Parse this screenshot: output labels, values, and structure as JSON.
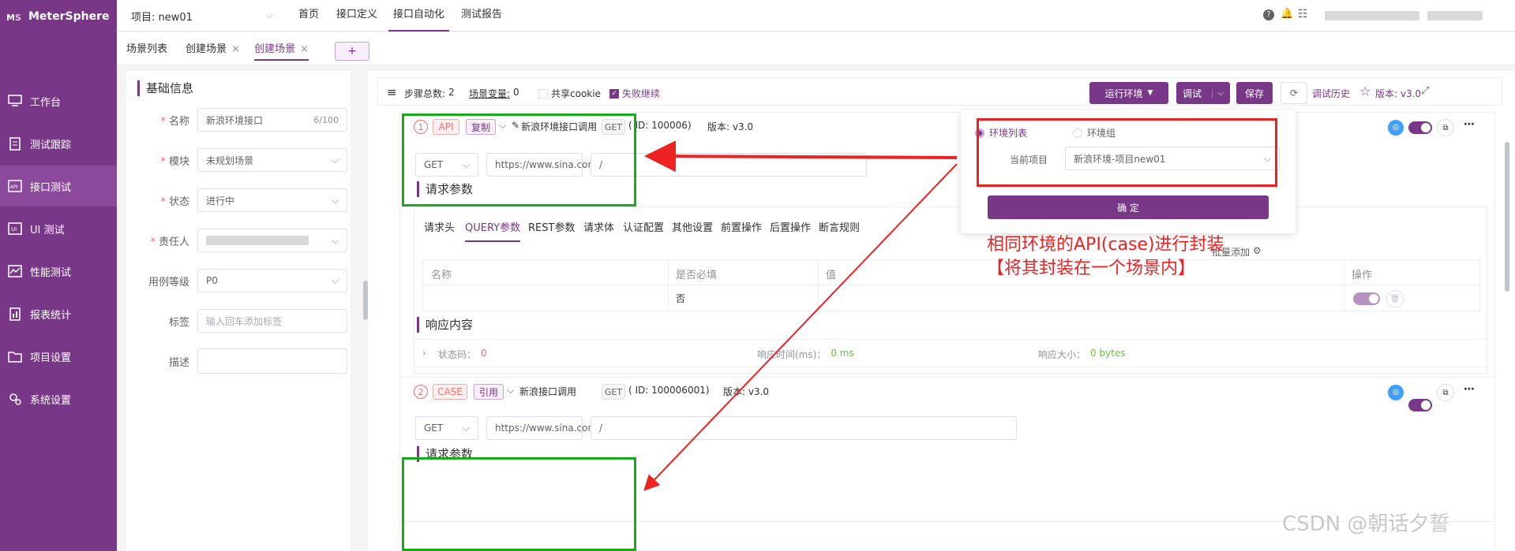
{
  "app": {
    "name": "MeterSphere"
  },
  "sidebar": {
    "items": [
      {
        "label": "工作台",
        "icon": "monitor-icon"
      },
      {
        "label": "测试跟踪",
        "icon": "clipboard-icon"
      },
      {
        "label": "接口测试",
        "icon": "api-icon",
        "active": true
      },
      {
        "label": "UI 测试",
        "icon": "ui-icon"
      },
      {
        "label": "性能测试",
        "icon": "chart-icon"
      },
      {
        "label": "报表统计",
        "icon": "report-icon"
      },
      {
        "label": "项目设置",
        "icon": "folder-icon"
      },
      {
        "label": "系统设置",
        "icon": "gear-icon"
      }
    ]
  },
  "topbar": {
    "project": "项目: new01",
    "nav": [
      "首页",
      "接口定义",
      "接口自动化",
      "测试报告"
    ],
    "active_nav": "接口自动化"
  },
  "tabs": {
    "items": [
      "场景列表",
      "创建场景",
      "创建场景"
    ],
    "add": "+"
  },
  "form": {
    "title": "基础信息",
    "name_label": "名称",
    "name_value": "新浪环境接口",
    "name_count": "6/100",
    "module_label": "模块",
    "module_value": "未规划场景",
    "status_label": "状态",
    "status_value": "进行中",
    "owner_label": "责任人",
    "level_label": "用例等级",
    "level_value": "P0",
    "tags_label": "标签",
    "tags_placeholder": "输入回车添加标签",
    "desc_label": "描述"
  },
  "toolbar": {
    "steps_label": "步骤总数:",
    "steps_value": "2",
    "vars_label": "场景变量:",
    "vars_value": "0",
    "share_cookie": "共享cookie",
    "fail_continue": "失败继续",
    "run_env": "运行环境",
    "debug": "调试",
    "save": "保存",
    "history": "调试历史",
    "version": "版本: v3.0"
  },
  "step1": {
    "num": "1",
    "type": "API",
    "tag": "复制",
    "name": "新浪环境接口调用",
    "method": "GET",
    "id_text": "( ID: 100006)",
    "version": "版本: v3.0",
    "method_select": "GET",
    "url": "https://www.sina.con",
    "path": "/"
  },
  "request": {
    "title": "请求参数",
    "tabs": [
      "请求头",
      "QUERY参数",
      "REST参数",
      "请求体",
      "认证配置",
      "其他设置",
      "前置操作",
      "后置操作",
      "断言规则"
    ],
    "active_tab": "QUERY参数",
    "batch_add": "批量添加",
    "columns": [
      "名称",
      "是否必填",
      "值",
      "操作"
    ],
    "row_required": "否"
  },
  "response": {
    "title": "响应内容",
    "status_label": "状态码：",
    "status_value": "0",
    "time_label": "响应时间(ms)：",
    "time_value": "0 ms",
    "size_label": "响应大小：",
    "size_value": "0 bytes"
  },
  "step2": {
    "num": "2",
    "type": "CASE",
    "tag": "引用",
    "name": "新浪接口调用",
    "method": "GET",
    "id_text": "( ID: 100006001)",
    "version": "版本: v3.0",
    "method_select": "GET",
    "url": "https://www.sina.con",
    "path": "/",
    "section": "请求参数"
  },
  "env_popup": {
    "option_list": "环境列表",
    "option_group": "环境组",
    "project_label": "当前项目",
    "project_value": "新浪环境-项目new01",
    "confirm": "确 定"
  },
  "annotation": {
    "line1": "相同环境的API(case)进行封装",
    "line2": "【将其封装在一个场景内】"
  },
  "watermark": "CSDN @朝话夕誓",
  "colors": {
    "brand": "#783887",
    "annotation": "#ee2222",
    "highlight": "#1aab1a"
  }
}
